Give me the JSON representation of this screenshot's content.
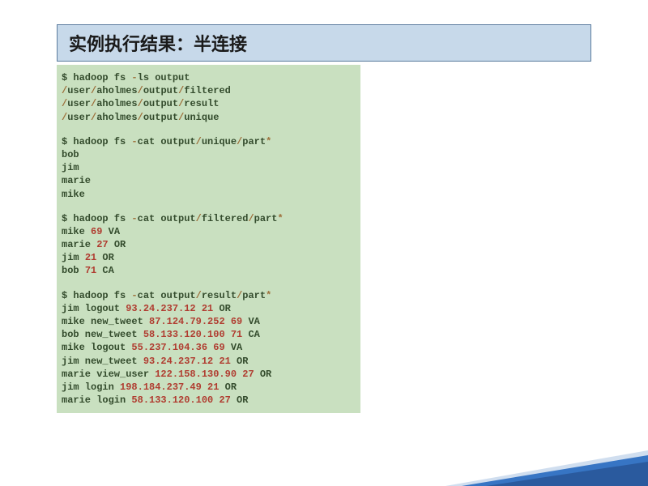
{
  "title": "实例执行结果：半连接",
  "t": {
    "cmd1_a": "$ hadoop fs ",
    "cmd1_op1": "-",
    "cmd1_b": "ls output",
    "ls_a": "/",
    "ls1_1": "user",
    "ls1_2": "aholmes",
    "ls1_3": "output",
    "ls1_4": "filtered",
    "ls2_1": "user",
    "ls2_2": "aholmes",
    "ls2_3": "output",
    "ls2_4": "result",
    "ls3_1": "user",
    "ls3_2": "aholmes",
    "ls3_3": "output",
    "ls3_4": "unique",
    "cmd2_a": "$ hadoop fs ",
    "cmd2_b": "cat output",
    "cmd2_c": "unique",
    "cmd2_d": "part",
    "u1": "bob",
    "u2": "jim",
    "u3": "marie",
    "u4": "mike",
    "cmd3_a": "$ hadoop fs ",
    "cmd3_b": "cat output",
    "cmd3_c": "filtered",
    "cmd3_d": "part",
    "f1_a": "mike ",
    "f1_n": "69",
    "f1_b": " VA",
    "f2_a": "marie ",
    "f2_n": "27",
    "f2_b": " OR",
    "f3_a": "jim ",
    "f3_n": "21",
    "f3_b": " OR",
    "f4_a": "bob ",
    "f4_n": "71",
    "f4_b": " CA",
    "cmd4_a": "$ hadoop fs ",
    "cmd4_b": "cat output",
    "cmd4_c": "result",
    "cmd4_d": "part",
    "r1_a": "jim logout ",
    "r1_ip": "93.24.237.12",
    "r1_b": " ",
    "r1_n": "21",
    "r1_c": " OR",
    "r2_a": "mike new_tweet ",
    "r2_ip": "87.124.79.252",
    "r2_b": " ",
    "r2_n": "69",
    "r2_c": " VA",
    "r3_a": "bob new_tweet ",
    "r3_ip": "58.133.120.100",
    "r3_b": " ",
    "r3_n": "71",
    "r3_c": " CA",
    "r4_a": "mike logout ",
    "r4_ip": "55.237.104.36",
    "r4_b": " ",
    "r4_n": "69",
    "r4_c": " VA",
    "r5_a": "jim new_tweet ",
    "r5_ip": "93.24.237.12",
    "r5_b": " ",
    "r5_n": "21",
    "r5_c": " OR",
    "r6_a": "marie view_user ",
    "r6_ip": "122.158.130.90",
    "r6_b": " ",
    "r6_n": "27",
    "r6_c": " OR",
    "r7_a": "jim login ",
    "r7_ip": "198.184.237.49",
    "r7_b": " ",
    "r7_n": "21",
    "r7_c": " OR",
    "r8_a": "marie login ",
    "r8_ip": "58.133.120.100",
    "r8_b": " ",
    "r8_n": "27",
    "r8_c": " OR",
    "slash": "/",
    "dash": "-",
    "star": "*"
  }
}
